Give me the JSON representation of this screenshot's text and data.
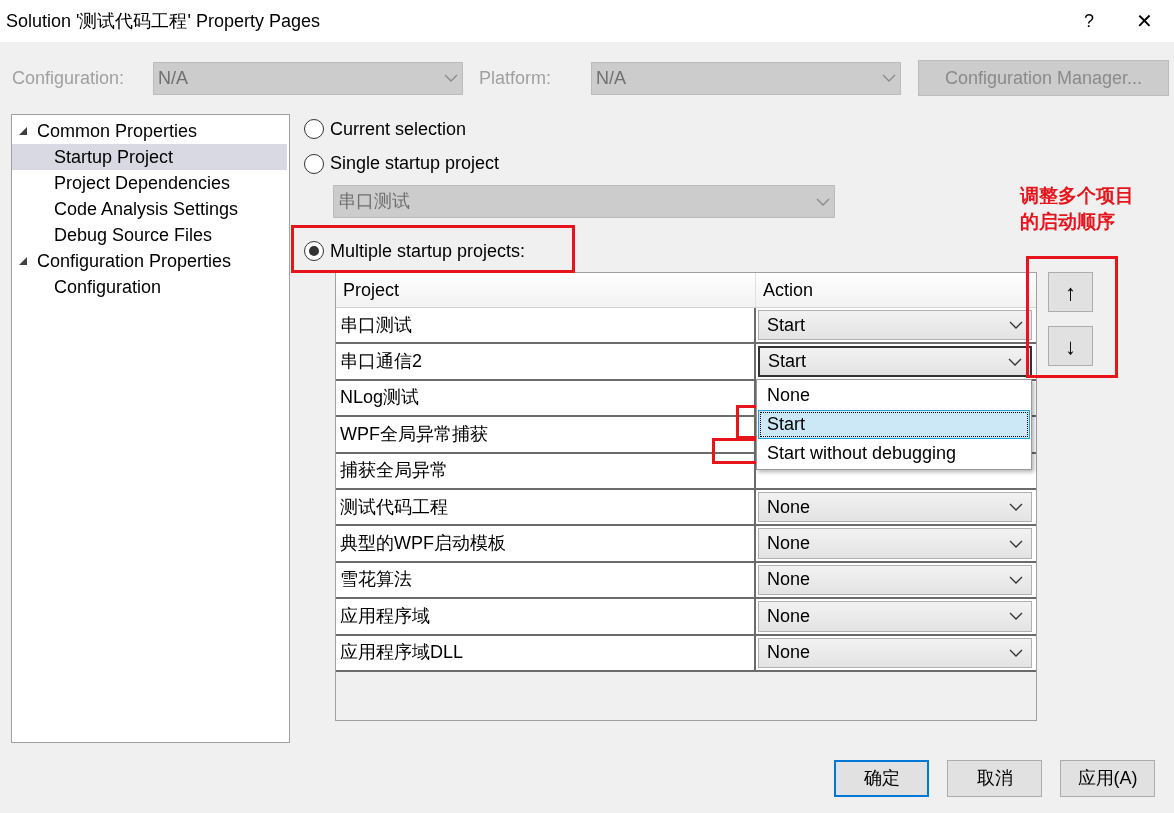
{
  "window": {
    "title": "Solution '测试代码工程' Property Pages",
    "help": "?",
    "close": "✕"
  },
  "toolbar": {
    "configuration_label": "Configuration:",
    "configuration_value": "N/A",
    "platform_label": "Platform:",
    "platform_value": "N/A",
    "manager_button": "Configuration Manager...",
    "disabled": true
  },
  "tree": [
    {
      "label": "Common Properties",
      "expanded": true,
      "selected": false,
      "children": [
        {
          "label": "Startup Project",
          "selected": true
        },
        {
          "label": "Project Dependencies",
          "selected": false
        },
        {
          "label": "Code Analysis Settings",
          "selected": false
        },
        {
          "label": "Debug Source Files",
          "selected": false
        }
      ]
    },
    {
      "label": "Configuration Properties",
      "expanded": true,
      "selected": false,
      "children": [
        {
          "label": "Configuration",
          "selected": false
        }
      ]
    }
  ],
  "startup_options": [
    {
      "label": "Current selection",
      "selected": false
    },
    {
      "label": "Single startup project",
      "selected": false
    },
    {
      "label": "Multiple startup projects:",
      "selected": true
    }
  ],
  "single_project_combo": {
    "value": "串口测试",
    "disabled": true
  },
  "table": {
    "columns": [
      "Project",
      "Action"
    ],
    "rows": [
      {
        "project": "串口测试",
        "action": "Start",
        "focused": false
      },
      {
        "project": "串口通信2",
        "action": "Start",
        "focused": true
      },
      {
        "project": "NLog测试"
      },
      {
        "project": "WPF全局异常捕获"
      },
      {
        "project": "捕获全局异常"
      },
      {
        "project": "测试代码工程",
        "action": "None",
        "focused": false
      },
      {
        "project": "典型的WPF启动模板",
        "action": "None",
        "focused": false
      },
      {
        "project": "雪花算法",
        "action": "None",
        "focused": false
      },
      {
        "project": "应用程序域",
        "action": "None",
        "focused": false
      },
      {
        "project": "应用程序域DLL",
        "action": "None",
        "focused": false
      }
    ]
  },
  "dropdown": {
    "options": [
      {
        "label": "None",
        "selected": false
      },
      {
        "label": "Start",
        "selected": true
      },
      {
        "label": "Start without debugging",
        "selected": false
      }
    ]
  },
  "move_buttons": [
    "↑",
    "↓"
  ],
  "annotation": {
    "lines": [
      "调整多个项目",
      "的启动顺序"
    ]
  },
  "buttons": [
    {
      "label": "确定",
      "default": true
    },
    {
      "label": "取消",
      "default": false
    },
    {
      "label": "应用(A)",
      "default": false
    }
  ]
}
